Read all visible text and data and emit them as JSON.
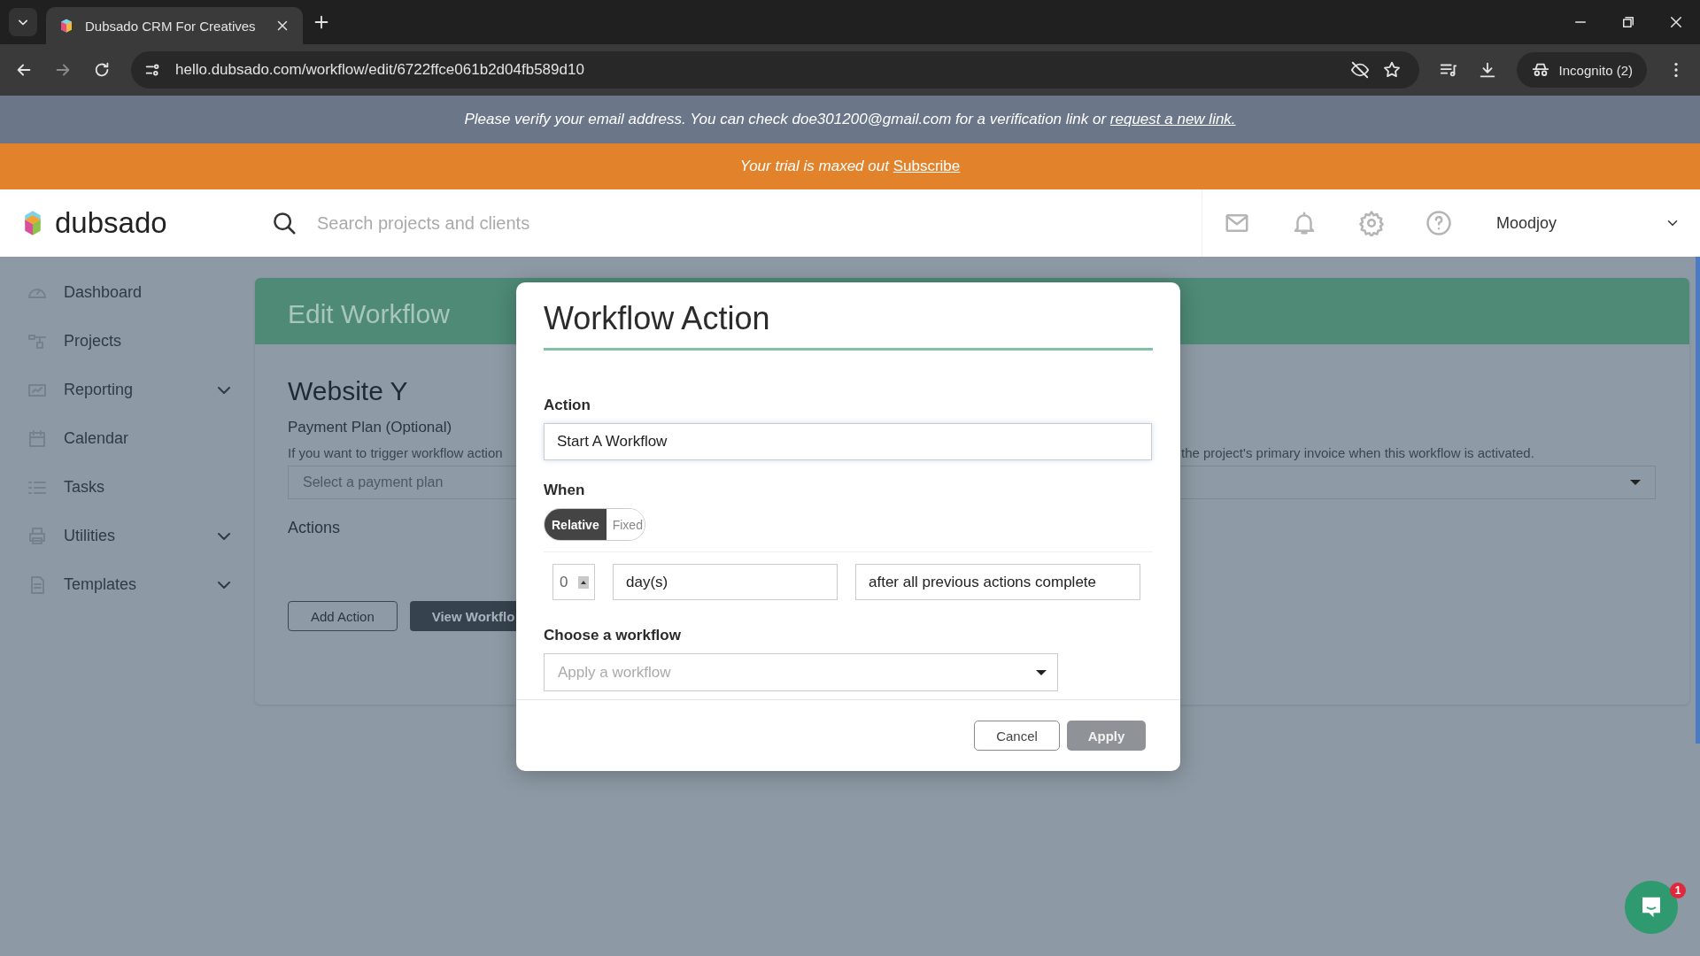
{
  "browser": {
    "tabs": [
      {
        "title": "Dubsado CRM For Creatives",
        "selected": true
      }
    ],
    "url": "hello.dubsado.com/workflow/edit/6722ffce061b2d04fb589d10",
    "profile": "Incognito (2)"
  },
  "banners": [
    {
      "kind": "notice",
      "text": "Please verify your email address. You can check doe301200@gmail.com for a verification link or ",
      "link": "request a new link."
    },
    {
      "kind": "warning",
      "text": "Your trial is maxed out ",
      "link": "Subscribe"
    }
  ],
  "header": {
    "logo": "dubsado",
    "search": {
      "placeholder": "Search projects and clients"
    },
    "user": "Moodjoy"
  },
  "sidebar": {
    "items": [
      {
        "label": "Dashboard",
        "expandable": false
      },
      {
        "label": "Projects",
        "expandable": false
      },
      {
        "label": "Reporting",
        "expandable": true
      },
      {
        "label": "Calendar",
        "expandable": false
      },
      {
        "label": "Tasks",
        "expandable": false
      },
      {
        "label": "Utilities",
        "expandable": true
      },
      {
        "label": "Templates",
        "expandable": true
      }
    ]
  },
  "page": {
    "title": "Edit Workflow",
    "workflow_name": "Website Y",
    "payment_plan": {
      "label": "Payment Plan (Optional)",
      "help_start": "If you want to trigger workflow action",
      "help_end": "the project's primary invoice when this workflow is activated.",
      "placeholder": "Select a payment plan"
    },
    "actions_label": "Actions",
    "buttons": [
      {
        "label": "Add Action",
        "kind": "outline"
      },
      {
        "label": "View Workflo",
        "kind": "dark"
      }
    ]
  },
  "dialog": {
    "title": "Workflow Action",
    "action": {
      "label": "Action",
      "value": "Start A Workflow"
    },
    "when": {
      "label": "When",
      "modes": [
        {
          "label": "Relative",
          "selected": true
        },
        {
          "label": "Fixed",
          "selected": false
        }
      ],
      "amount": "0",
      "unit": "day(s)",
      "relation": "after all previous actions complete"
    },
    "workflow": {
      "label": "Choose a workflow",
      "placeholder": "Apply a workflow"
    },
    "buttons": [
      {
        "label": "Cancel",
        "kind": "secondary",
        "disabled": false
      },
      {
        "label": "Apply",
        "kind": "primary",
        "disabled": true
      }
    ]
  },
  "chat": {
    "badge": "1"
  }
}
